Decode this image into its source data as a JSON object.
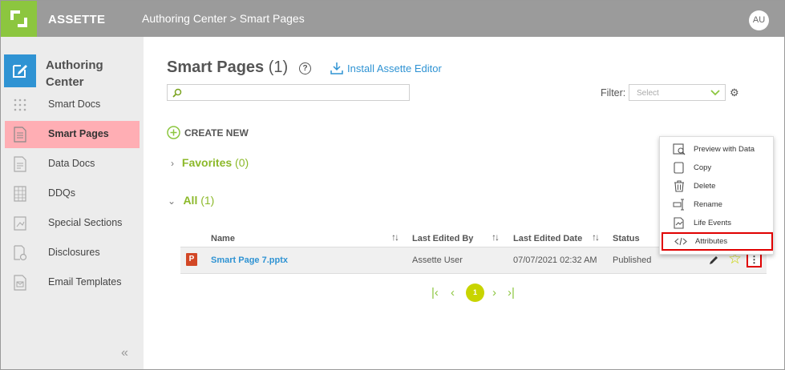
{
  "header": {
    "brand": "ASSETTE",
    "breadcrumb": "Authoring Center > Smart Pages",
    "avatar": "AU"
  },
  "sidebar": {
    "title_line1": "Authoring",
    "title_line2": "Center",
    "items": [
      {
        "label": "Smart Docs",
        "icon": "grid-dots-icon"
      },
      {
        "label": "Smart Pages",
        "icon": "page-icon",
        "active": true
      },
      {
        "label": "Data Docs",
        "icon": "data-doc-icon"
      },
      {
        "label": "DDQs",
        "icon": "ddq-icon"
      },
      {
        "label": "Special Sections",
        "icon": "special-section-icon"
      },
      {
        "label": "Disclosures",
        "icon": "disclosure-icon"
      },
      {
        "label": "Email Templates",
        "icon": "email-template-icon"
      }
    ],
    "collapse_glyph": "«"
  },
  "main": {
    "title": "Smart Pages",
    "title_count": "(1)",
    "help_glyph": "?",
    "install_label": "Install Assette Editor",
    "filter_label": "Filter:",
    "filter_placeholder": "Select",
    "create_label": "CREATE NEW",
    "favorites_label": "Favorites",
    "favorites_count": "(0)",
    "all_label": "All",
    "all_count": "(1)"
  },
  "table": {
    "columns": [
      "Name",
      "Last Edited By",
      "Last Edited Date",
      "Status"
    ],
    "rows": [
      {
        "name": "Smart Page 7.pptx",
        "last_edited_by": "Assette User",
        "last_edited_date": "07/07/2021 02:32 AM",
        "status": "Published",
        "file_icon": "P"
      }
    ]
  },
  "pagination": {
    "current": "1"
  },
  "context_menu": {
    "items": [
      {
        "label": "Preview with Data",
        "icon": "preview-icon"
      },
      {
        "label": "Copy",
        "icon": "copy-icon"
      },
      {
        "label": "Delete",
        "icon": "trash-icon"
      },
      {
        "label": "Rename",
        "icon": "rename-icon"
      },
      {
        "label": "Life Events",
        "icon": "life-events-icon"
      },
      {
        "label": "Attributes",
        "icon": "code-icon",
        "highlighted": true
      }
    ]
  },
  "colors": {
    "brand_green": "#8cc63f",
    "accent_blue": "#2f93d3",
    "active_item": "#ffaeb4",
    "highlight_red": "#e00000",
    "star_yellow": "#c8d400"
  }
}
